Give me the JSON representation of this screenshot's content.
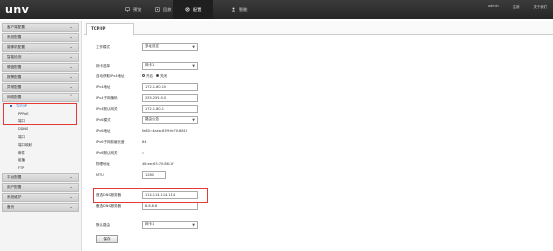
{
  "app": {
    "logo": "unv"
  },
  "topnav": {
    "items": [
      {
        "label": "预览"
      },
      {
        "label": "回放"
      },
      {
        "label": "配置"
      },
      {
        "label": "智能"
      }
    ],
    "user_links": [
      "admin",
      "注销",
      "关于我们"
    ]
  },
  "sidebar": {
    "menus_top": [
      "客户端配置",
      "系统配置",
      "摄像机配置",
      "智能检测",
      "硬盘配置",
      "报警配置",
      "异常配置"
    ],
    "open_menu": "网络配置",
    "sub_items": [
      "TCP/IP",
      "PPPoE",
      "端口",
      "DDNS",
      "端口",
      "端口映射",
      "邮件",
      "组播",
      "FTP"
    ],
    "menus_bottom": [
      "平台配置",
      "用户配置",
      "系统维护",
      "备份"
    ]
  },
  "content": {
    "tab": "TCP/IP",
    "fields": {
      "work_mode_label": "工作模式",
      "work_mode_value": "多址设定",
      "nic_label": "网卡选择",
      "nic_value": "网卡1",
      "dhcp_label": "自动获取IPv4地址",
      "dhcp_on": "开启",
      "dhcp_off": "关闭",
      "ipv4_label": "IPv4地址",
      "ipv4_value": "172.1.80.10",
      "mask_label": "IPv4子网掩码",
      "mask_value": "255.255.0.0",
      "gw_label": "IPv4默认网关",
      "gw_value": "172.1.80.1",
      "ipv6_mode_label": "IPv6模式",
      "ipv6_mode_value": "路由公告",
      "ipv6_label": "IPv6地址",
      "ipv6_value": "fe80::4aea:63ff:fe70:881f",
      "ipv6_prefix_label": "IPv6子网前缀长度",
      "ipv6_prefix_value": "64",
      "ipv6_gw_label": "IPv6默认网关",
      "ipv6_gw_value": "::",
      "mac_label": "物理地址",
      "mac_value": "48:ea:63:70:88:1f",
      "mtu_label": "MTU",
      "mtu_value": "1280",
      "dns1_label": "首选DNS服务器",
      "dns1_value": "114.114.114.114",
      "dns2_label": "备选DNS服务器",
      "dns2_value": "8.8.8.8",
      "default_route_label": "默认路由",
      "default_route_value": "网卡1"
    },
    "save_label": "保存"
  }
}
